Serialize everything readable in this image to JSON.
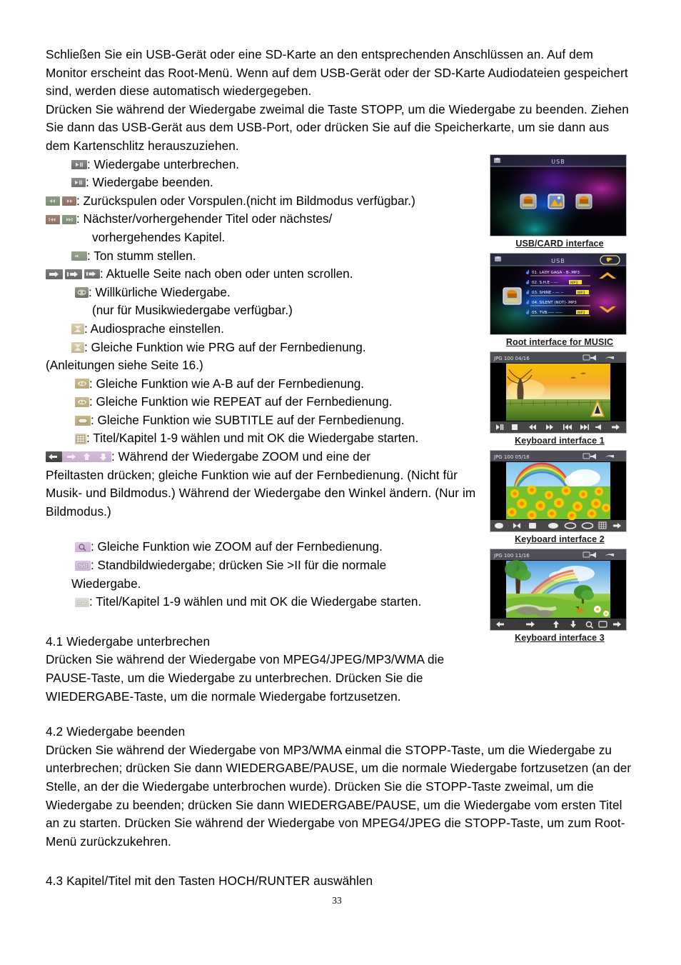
{
  "document": {
    "page_number": "33",
    "intro_paragraph_1": "Schließen Sie ein USB-Gerät oder eine SD-Karte an den entsprechenden Anschlüssen an. Auf dem Monitor erscheint das Root-Menü. Wenn auf dem USB-Gerät oder der SD-Karte Audiodateien gespeichert sind, werden diese automatisch wiedergegeben.",
    "intro_paragraph_2": "Drücken Sie während der Wiedergabe zweimal die Taste STOPP, um die Wiedergabe zu beenden. Ziehen Sie dann das USB-Gerät aus dem USB-Port, oder drücken Sie auf die Speicherkarte, um sie dann aus dem Kartenschlitz herauszuziehen."
  },
  "legend": {
    "items": [
      {
        "icons": "play-pause-button",
        "text": ": Wiedergabe unterbrechen."
      },
      {
        "icons": "stop-button",
        "text": ": Wiedergabe beenden."
      },
      {
        "icons": "rewind-fastforward-buttons",
        "text": ": Zurückspulen oder Vorspulen.(nicht im Bildmodus verfügbar.)"
      },
      {
        "icons": "previous-next-track-buttons",
        "text": ": Nächster/vorhergehender Titel oder nächstes/"
      },
      {
        "icons": "",
        "text": "vorhergehendes Kapitel."
      },
      {
        "icons": "mute-button",
        "text": ": Ton stumm stellen."
      },
      {
        "icons": "page-scroll-buttons",
        "text": ": Aktuelle Seite nach oben oder unten scrollen."
      },
      {
        "icons": "random-play-button",
        "text": ": Willkürliche Wiedergabe."
      },
      {
        "icons": "",
        "text": "(nur für Musikwiedergabe verfügbar.)"
      },
      {
        "icons": "audio-language-button",
        "text": ": Audiosprache einstellen."
      },
      {
        "icons": "program-button",
        "text": ": Gleiche Funktion wie PRG auf der Fernbedienung."
      },
      {
        "icons": "",
        "text": "(Anleitungen siehe Seite 16.)"
      },
      {
        "icons": "ab-repeat-button",
        "text": ": Gleiche Funktion wie A-B auf der Fernbedienung."
      },
      {
        "icons": "repeat-button",
        "text": ": Gleiche Funktion wie REPEAT auf der Fernbedienung."
      },
      {
        "icons": "subtitle-button",
        "text": ": Gleiche Funktion wie SUBTITLE auf der Fernbedienung."
      },
      {
        "icons": "goto-grid-button",
        "text": ": Titel/Kapitel 1-9 wählen und mit OK die Wiedergabe starten."
      },
      {
        "icons": "direction-arrow-buttons",
        "text": ": Während der Wiedergabe ZOOM und eine der"
      }
    ],
    "zoom_paragraph": "Pfeiltasten drücken; gleiche Funktion wie auf der Fernbedienung. (Nicht für Musik- und Bildmodus.) Während der Wiedergabe den Winkel ändern. (Nur im Bildmodus.)",
    "items_after": [
      {
        "icons": "zoom-button",
        "text": ": Gleiche Funktion wie ZOOM auf der Fernbedienung."
      },
      {
        "icons": "step-button",
        "text": ": Standbildwiedergabe; drücken Sie >II für die normale"
      },
      {
        "icons": "",
        "text": "Wiedergabe."
      },
      {
        "icons": "goto-button",
        "text": ": Titel/Kapitel 1-9 wählen und mit OK die Wiedergabe starten."
      }
    ]
  },
  "sections": {
    "s41": {
      "heading": "4.1 Wiedergabe unterbrechen",
      "body": "Drücken Sie während der Wiedergabe von MPEG4/JPEG/MP3/WMA die PAUSE-Taste, um die Wiedergabe zu unterbrechen. Drücken Sie die WIEDERGABE-Taste, um die normale Wiedergabe fortzusetzen."
    },
    "s42": {
      "heading": "4.2 Wiedergabe beenden",
      "body": "Drücken Sie während der Wiedergabe von MP3/WMA einmal die STOPP-Taste, um die Wiedergabe zu unterbrechen; drücken Sie dann WIEDERGABE/PAUSE, um die normale Wiedergabe fortzusetzen (an der Stelle, an der die Wiedergabe unterbrochen wurde). Drücken Sie die STOPP-Taste zweimal, um die Wiedergabe zu beenden; drücken Sie dann WIEDERGABE/PAUSE, um die Wiedergabe vom ersten Titel an zu starten. Drücken Sie während der Wiedergabe von MPEG4/JPEG die STOPP-Taste, um zum Root-Menü zurückzukehren."
    },
    "s43": {
      "heading": "4.3 Kapitel/Titel mit den Tasten HOCH/RUNTER auswählen"
    }
  },
  "figures": [
    {
      "caption": "USB/CARD  interface",
      "screen_title": "USB",
      "icon": "home-icon"
    },
    {
      "caption": "Root interface for MUSIC",
      "screen_title": "USB",
      "icon": "home-icon",
      "tracks": [
        "01. LADY GAGA - B-.MP3",
        "02. S.H.E - ---.MP3",
        "03. SHINE -  --- --.MP3",
        "04. SILENT (NOT)-.MP3",
        "05. TVB.---- ----- .MP3"
      ]
    },
    {
      "caption": "Keyboard interface 1",
      "screen_title": "JPG  100  04/16",
      "keys": [
        "play-pause",
        "stop",
        "rewind",
        "fast-forward",
        "previous",
        "next",
        "mute",
        "page-scroll"
      ]
    },
    {
      "caption": "Keyboard interface 2",
      "screen_title": "JPG  100  05/16",
      "keys": [
        "random",
        "audio",
        "program",
        "ab-repeat",
        "repeat",
        "subtitle",
        "goto-grid",
        "page-scroll"
      ]
    },
    {
      "caption": "Keyboard interface 3",
      "screen_title": "JPG  100  11/16",
      "keys": [
        "arrow-left",
        "arrow-right",
        "arrow-up",
        "arrow-down",
        "zoom",
        "step",
        "goto",
        "page-scroll"
      ]
    }
  ],
  "colors": {
    "gray_button": "#7c7c7c",
    "dark_button": "#4a4a4a",
    "purple_button": "#cdb4d5",
    "tan_button": "#c3b793",
    "green_button": "#86927e",
    "red_button": "#8e7168"
  }
}
